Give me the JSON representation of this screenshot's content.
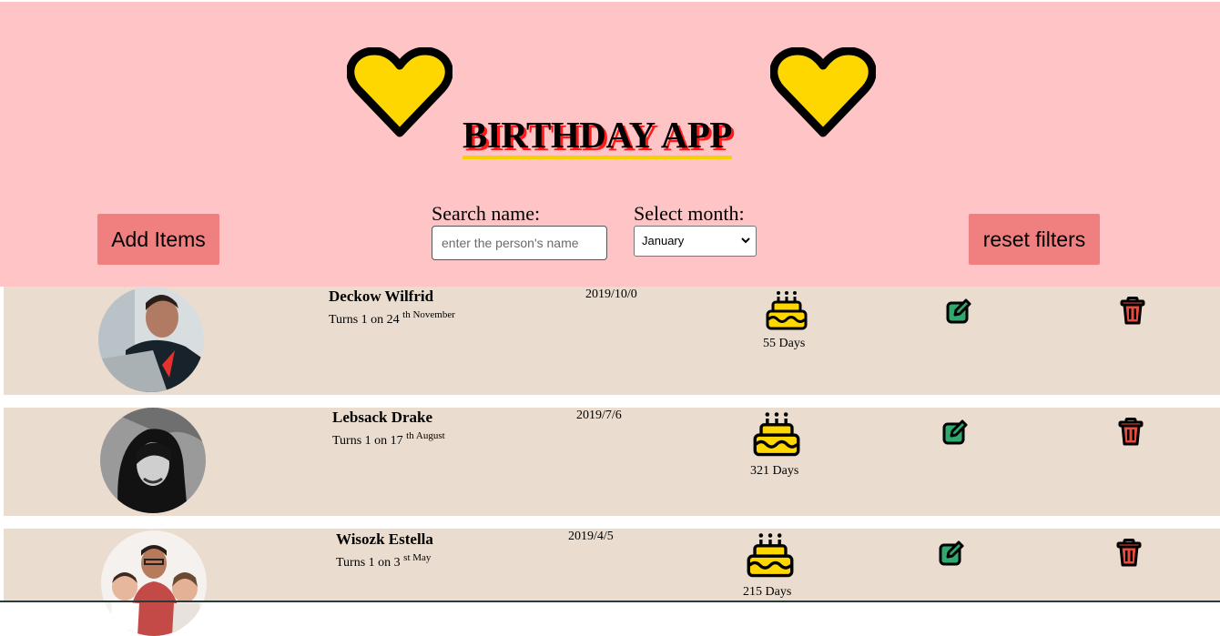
{
  "header": {
    "title": "BIRTHDAY APP",
    "add_button": "Add Items",
    "reset_button": "reset filters",
    "search_label": "Search name:",
    "search_placeholder": "enter the person's name",
    "search_value": "",
    "month_label": "Select month:",
    "month_value": "January"
  },
  "colors": {
    "header_bg": "#ffc4c5",
    "row_bg": "#eaddd0",
    "button_bg": "#f08080",
    "heart": "#ffd700",
    "edit": "#2eaa6e",
    "trash": "#e74c3c"
  },
  "people": [
    {
      "name": "Deckow Wilfrid",
      "turns_prefix": "Turns 1 on 24 ",
      "turns_sup": "th November",
      "date": "2019/10/0",
      "days": "55 Days"
    },
    {
      "name": "Lebsack Drake",
      "turns_prefix": "Turns 1 on 17 ",
      "turns_sup": "th August",
      "date": "2019/7/6",
      "days": "321 Days"
    },
    {
      "name": "Wisozk Estella",
      "turns_prefix": "Turns 1 on 3 ",
      "turns_sup": "st May",
      "date": "2019/4/5",
      "days": "215 Days"
    }
  ]
}
